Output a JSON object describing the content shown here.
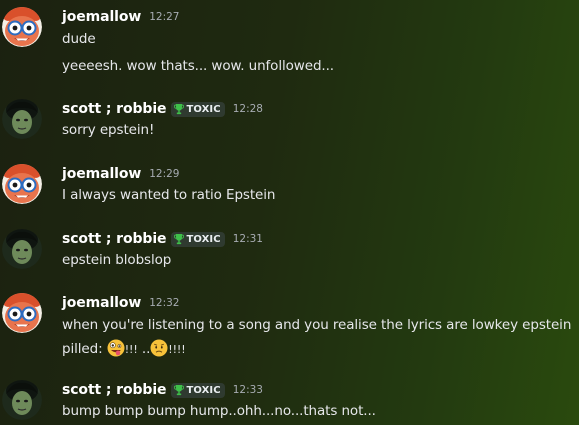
{
  "messages": [
    {
      "author": "joemallow",
      "tag": "",
      "time": "12:27",
      "lines": [
        "dude",
        "yeeeesh. wow thats... wow. unfollowed..."
      ],
      "avatar": "cartoon-bear-avatar"
    },
    {
      "author": "scott ; robbie",
      "tag": "TOXIC",
      "time": "12:28",
      "lines": [
        "sorry epstein!"
      ],
      "avatar": "dark-face-avatar"
    },
    {
      "author": "joemallow",
      "tag": "",
      "time": "12:29",
      "lines": [
        "I always wanted to ratio Epstein"
      ],
      "avatar": "cartoon-bear-avatar"
    },
    {
      "author": "scott ; robbie",
      "tag": "TOXIC",
      "time": "12:31",
      "lines": [
        "epstein blobslop"
      ],
      "avatar": "dark-face-avatar"
    },
    {
      "author": "joemallow",
      "tag": "",
      "time": "12:32",
      "lines": [
        "when you're listening to a song and you realise the lyrics are lowkey epstein"
      ],
      "line2_prefix": "pilled: ",
      "line2_bang1": "!!!",
      "line2_dots": " ..",
      "line2_bang2": "!!!!",
      "emojis": [
        "zany-face-emoji",
        "worried-face-emoji"
      ],
      "avatar": "cartoon-bear-avatar"
    },
    {
      "author": "scott ; robbie",
      "tag": "TOXIC",
      "time": "12:33",
      "lines": [
        "bump bump bump hump..ohh...no...thats not..."
      ],
      "avatar": "dark-face-avatar"
    }
  ],
  "colors": {
    "author": "#ffffff",
    "text": "#e6e7ea",
    "timestamp": "#a7acb2",
    "tag_bg": "#2f3a30",
    "tag_icon": "#3fbf4a"
  }
}
